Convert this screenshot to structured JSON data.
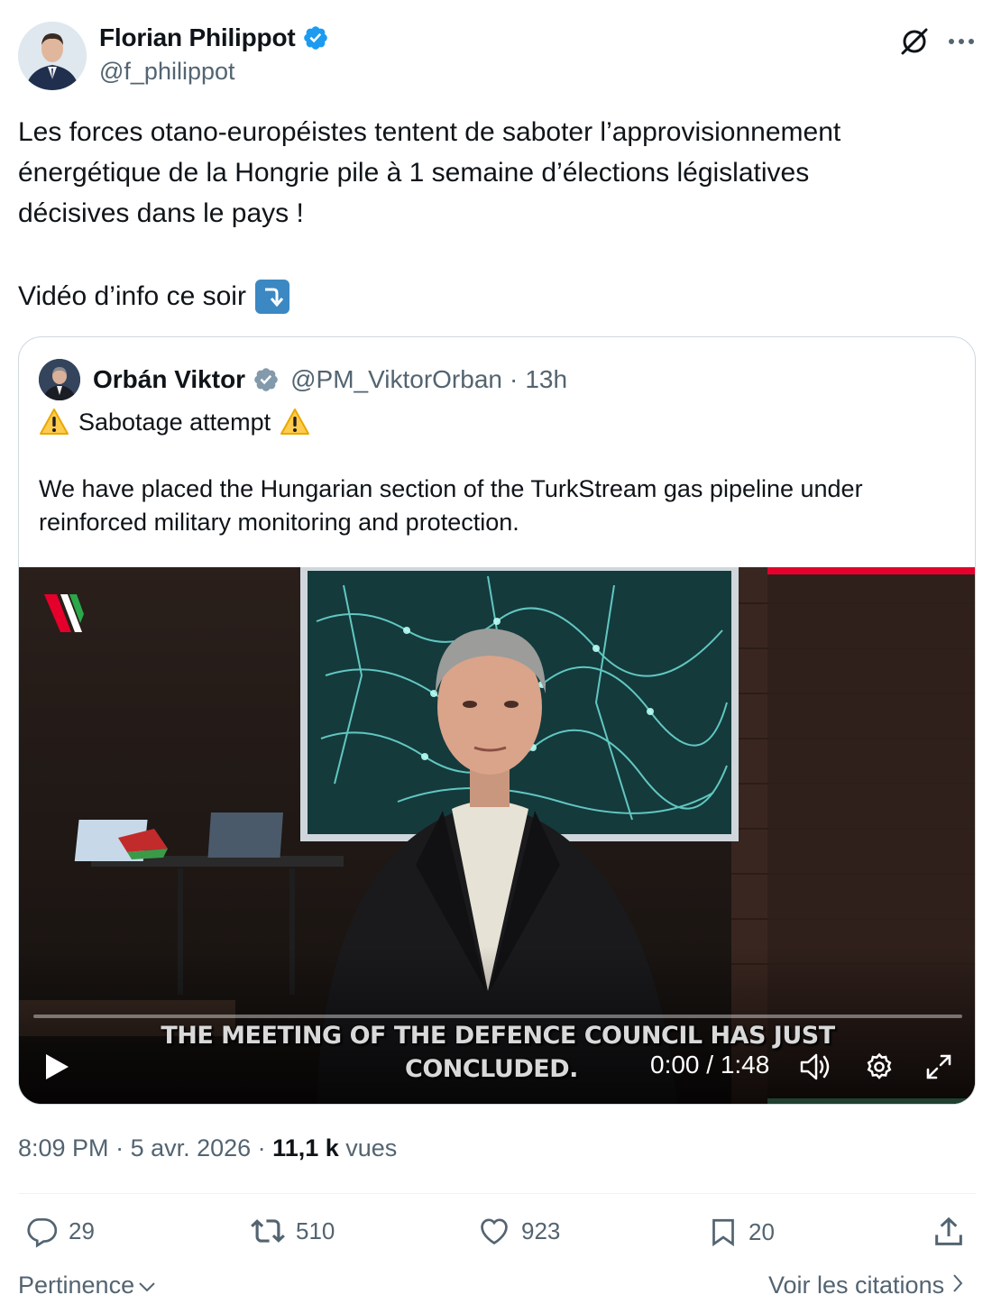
{
  "author": {
    "name": "Florian Philippot",
    "handle": "@f_philippot"
  },
  "tweet": {
    "text": "Les forces otano-européistes tentent de saboter l’approvisionnement\nénergétique de la Hongrie pile à 1 semaine d’élections législatives\ndécisives dans le pays !",
    "text_2": "Vidéo d’info ce soir"
  },
  "quote": {
    "name": "Orbán Viktor",
    "handle": "@PM_ViktorOrban",
    "separator": "·",
    "time": "13h",
    "line_1": "Sabotage attempt",
    "line_2": "We have placed the Hungarian section of the TurkStream gas pipeline under reinforced military monitoring and protection."
  },
  "video": {
    "subtitle_1": "THE MEETING OF THE DEFENCE COUNCIL HAS JUST",
    "subtitle_2": "CONCLUDED.",
    "time": "0:00 / 1:48",
    "progress": 0
  },
  "meta": {
    "time": "8:09 PM",
    "sep_1": " · ",
    "date": "5 avr. 2026",
    "sep_2": " · ",
    "views": "11,1 k",
    "views_label": " vues"
  },
  "actions": {
    "replies": "29",
    "retweets": "510",
    "likes": "923",
    "bookmarks": "20"
  },
  "footer": {
    "sort": "Pertinence",
    "quotes_link": "Voir les citations"
  },
  "colors": {
    "verified_blue": "#1d9bf0",
    "text_secondary": "#536471",
    "text_primary": "#0f1419",
    "border": "#cfd9de"
  },
  "icons": [
    "verified-badge-icon",
    "grok-icon",
    "more-icon",
    "arrow-down-right-icon",
    "gray-verified-badge-icon",
    "warning-icon",
    "play-icon",
    "volume-icon",
    "settings-icon",
    "fullscreen-icon",
    "reply-icon",
    "retweet-icon",
    "like-icon",
    "bookmark-icon",
    "share-icon",
    "chevron-down-icon",
    "chevron-right-icon"
  ]
}
